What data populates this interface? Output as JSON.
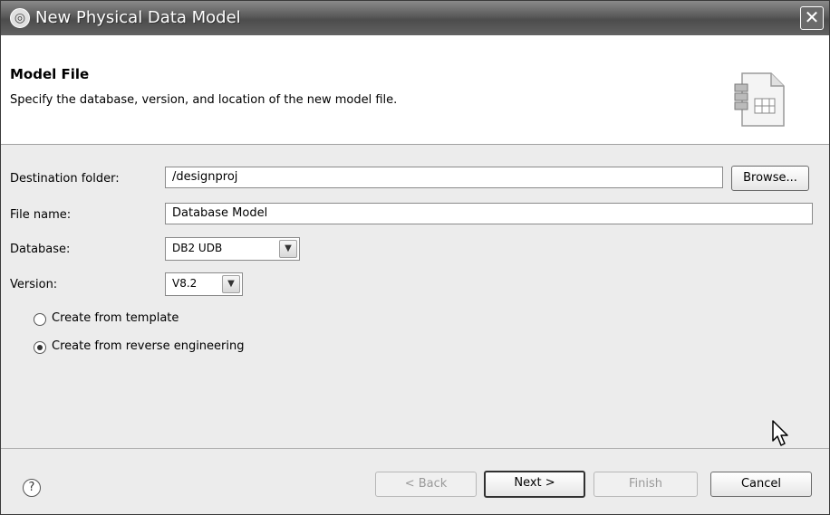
{
  "window": {
    "title": "New Physical Data Model",
    "close_glyph": "✕"
  },
  "banner": {
    "title": "Model File",
    "description": "Specify the database, version, and location of the new model file.",
    "image_icon": "data-model-file-icon"
  },
  "form": {
    "destination_label": "Destination folder:",
    "destination_value": "/designproj",
    "browse_label": "Browse...",
    "file_name_label": "File name:",
    "file_name_value": "Database Model",
    "database_label": "Database:",
    "database_value": "DB2 UDB",
    "version_label": "Version:",
    "version_value": "V8.2",
    "radio_template_label": "Create from template",
    "radio_reverse_label": "Create from reverse engineering",
    "selected_option": "Create from reverse engineering"
  },
  "footer": {
    "help_glyph": "?",
    "back_label": "< Back",
    "next_label": "Next >",
    "finish_label": "Finish",
    "cancel_label": "Cancel"
  },
  "icons": {
    "combo_arrow": "▼"
  }
}
